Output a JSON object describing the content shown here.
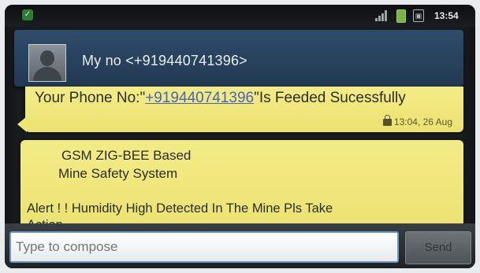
{
  "status_bar": {
    "time": "13:54",
    "icons": [
      "shield-icon",
      "signal-icon",
      "battery-icon",
      "sd-card-icon"
    ]
  },
  "header": {
    "title": "My no <+919440741396>",
    "avatar_icon": "contact-avatar-icon"
  },
  "messages": [
    {
      "text_before": "Your Phone No:\"",
      "link_text": "+919440741396",
      "text_after": "\"Is Feeded Sucessfully",
      "timestamp": "13:04, 26 Aug",
      "icon": "lock-icon"
    },
    {
      "line1": "GSM ZIG-BEE Based",
      "line2": "Mine  Safety  System",
      "line3": "Alert ! ! Humidity High  Detected In The Mine Pls Take",
      "line4": "Action"
    }
  ],
  "compose": {
    "placeholder": "Type to compose",
    "send_label": "Send"
  },
  "colors": {
    "bubble": "#ede575",
    "header": "#2a4460",
    "input_border": "#6b98c7"
  }
}
